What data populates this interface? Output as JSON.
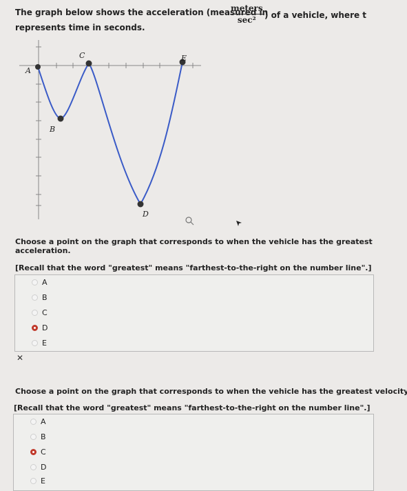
{
  "intro": {
    "text_before": "The graph below shows the acceleration (measured in",
    "unit_numerator": "meters",
    "unit_denominator": "sec²",
    "text_after": ") of a vehicle, where t",
    "line2": "represents time in seconds."
  },
  "graph": {
    "point_labels": [
      "A",
      "B",
      "C",
      "D",
      "E"
    ]
  },
  "question1": {
    "prompt": "Choose a point on the graph that corresponds to when the vehicle has the greatest acceleration.",
    "recall": "[Recall that the word \"greatest\" means \"farthest-to-the-right on the number line\".]",
    "options": [
      "A",
      "B",
      "C",
      "D",
      "E"
    ],
    "selected": "D",
    "result_mark": "✕"
  },
  "question2": {
    "prompt": "Choose a point on the graph that corresponds to when the vehicle has the greatest velocity.",
    "recall": "[Recall that the word \"greatest\" means \"farthest-to-the-right on the number line\".]",
    "options": [
      "A",
      "B",
      "C",
      "D",
      "E"
    ],
    "selected": "C"
  },
  "colors": {
    "curve": "#3a5bc7",
    "selected_radio": "#c0392b"
  }
}
